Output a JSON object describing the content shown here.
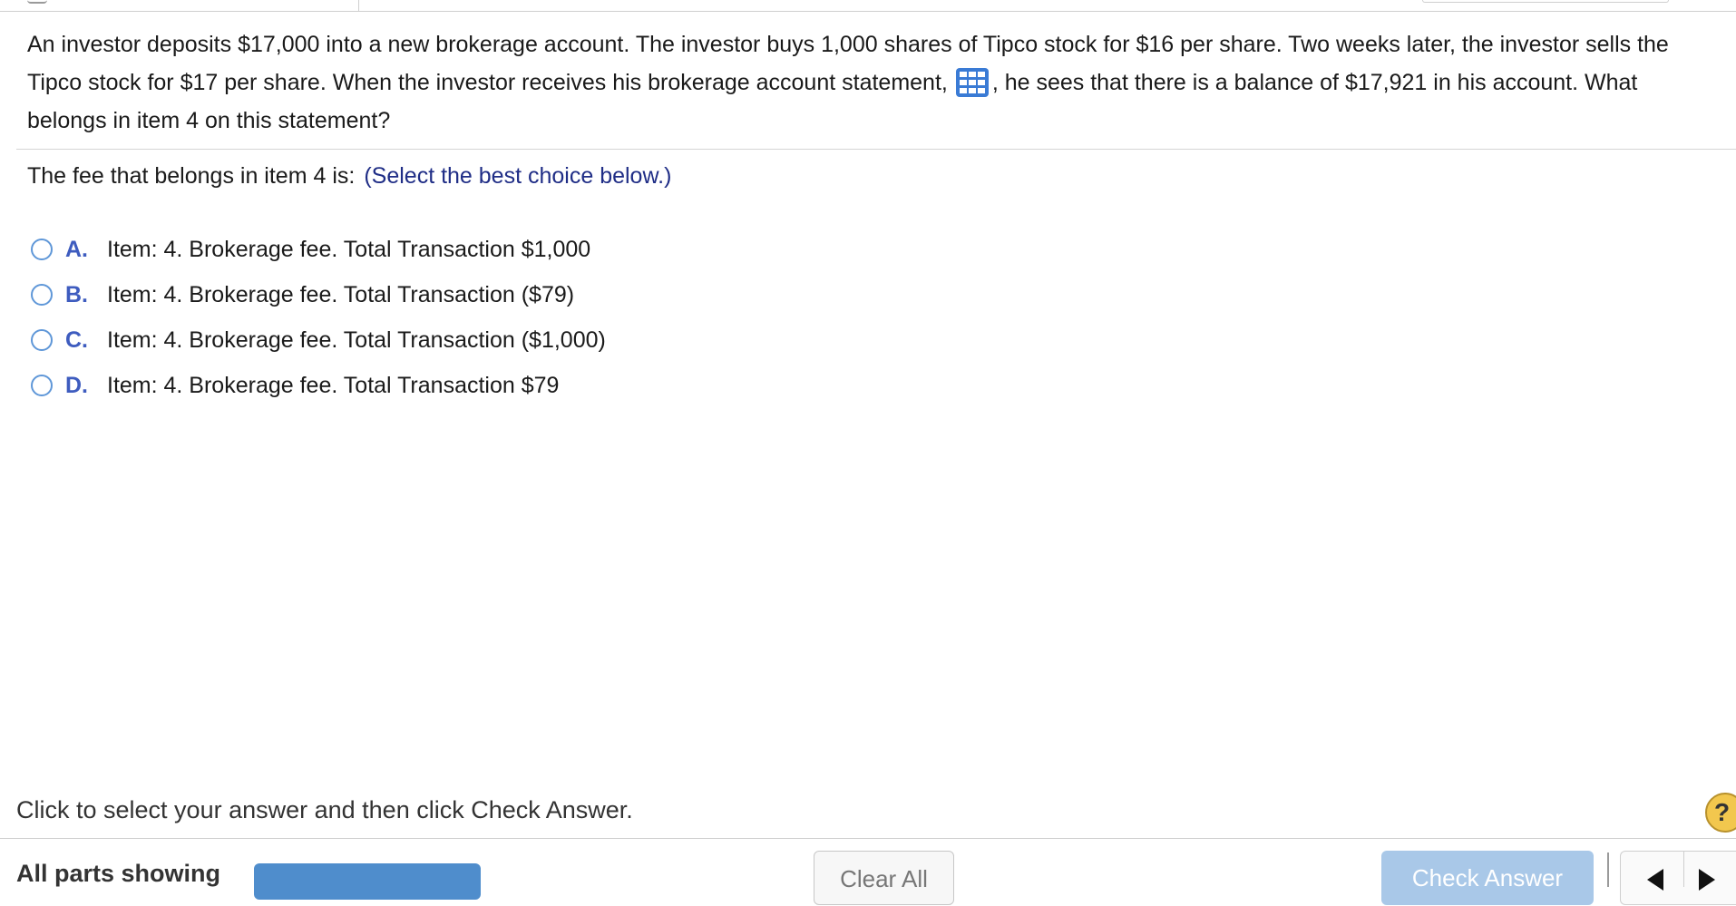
{
  "question": {
    "part1": "An investor deposits $17,000 into a new brokerage account. The investor buys 1,000 shares of Tipco stock for $16 per share. Two weeks later, the investor sells the Tipco stock for $17 per share. When the investor receives his brokerage account statement,",
    "icon": "table-icon",
    "part2": ", he sees that there is a balance of $17,921 in his account. What belongs in item 4 on this statement?"
  },
  "prompt": {
    "label": "The fee that belongs in item 4 is:",
    "instruction": "(Select the best choice below.)"
  },
  "choices": [
    {
      "letter": "A.",
      "text": "Item: 4. Brokerage fee. Total Transaction $1,000"
    },
    {
      "letter": "B.",
      "text": "Item: 4. Brokerage fee. Total Transaction ($79)"
    },
    {
      "letter": "C.",
      "text": "Item: 4. Brokerage fee. Total Transaction ($1,000)"
    },
    {
      "letter": "D.",
      "text": "Item: 4. Brokerage fee. Total Transaction $79"
    }
  ],
  "footer": {
    "hint": "Click to select your answer and then click Check Answer.",
    "help_label": "?",
    "parts_label": "All parts showing",
    "clear_label": "Clear All",
    "check_label": "Check Answer"
  },
  "colors": {
    "accent_blue": "#3e5cbf",
    "instruction_navy": "#1f2d86",
    "check_button": "#a9c8e8",
    "progress_bar": "#4f8dcc",
    "help_yellow": "#f2c74e"
  }
}
